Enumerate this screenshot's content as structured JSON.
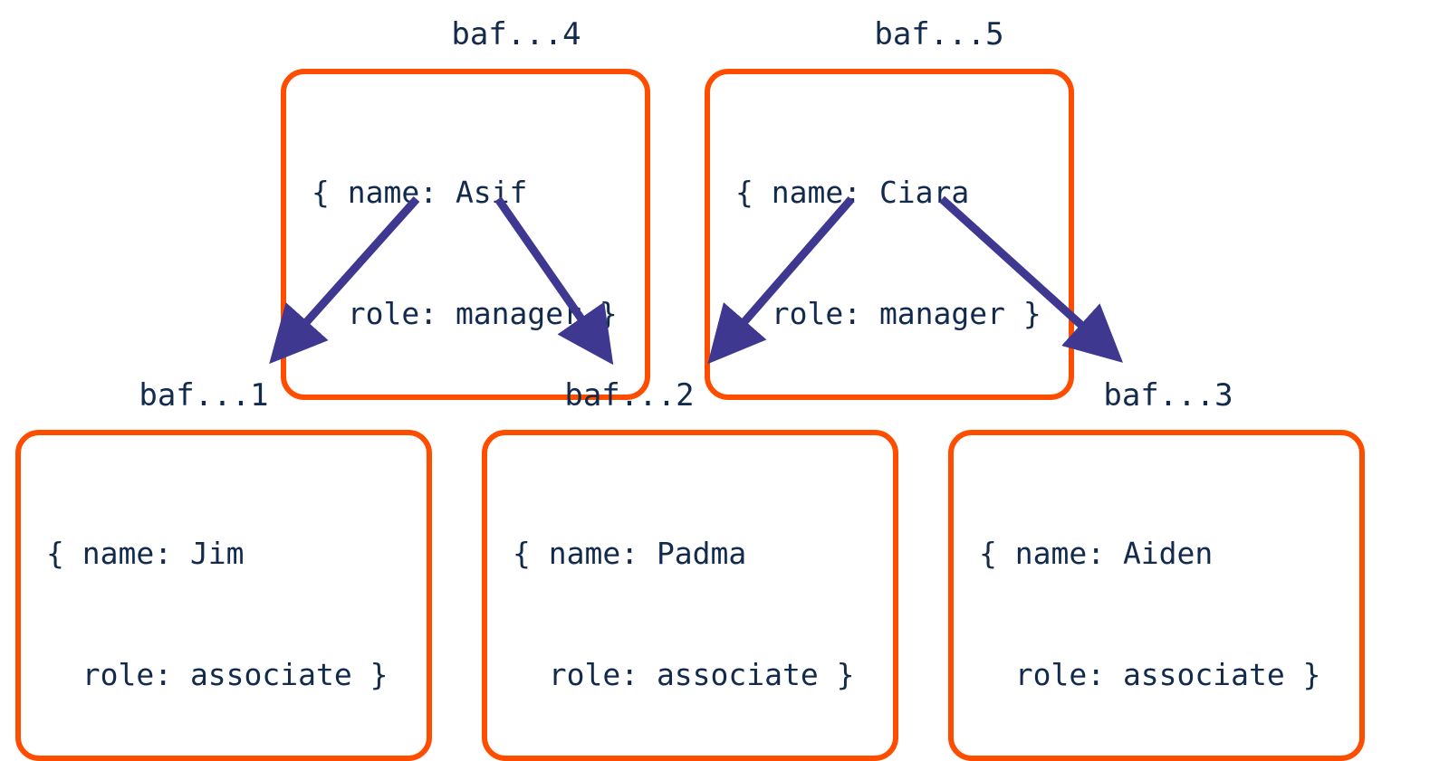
{
  "colors": {
    "text": "#122a4c",
    "box_border": "#ff4d00",
    "arrow": "#3e3890"
  },
  "nodes": {
    "top_left": {
      "label": "baf...4",
      "line1": "{ name: Asif",
      "line2": "  role: manager }"
    },
    "top_right": {
      "label": "baf...5",
      "line1": "{ name: Ciara",
      "line2": "  role: manager }"
    },
    "bottom_left": {
      "label": "baf...1",
      "line1": "{ name: Jim",
      "line2": "  role: associate }"
    },
    "bottom_middle": {
      "label": "baf...2",
      "line1": "{ name: Padma",
      "line2": "  role: associate }"
    },
    "bottom_right": {
      "label": "baf...3",
      "line1": "{ name: Aiden",
      "line2": "  role: associate }"
    }
  }
}
